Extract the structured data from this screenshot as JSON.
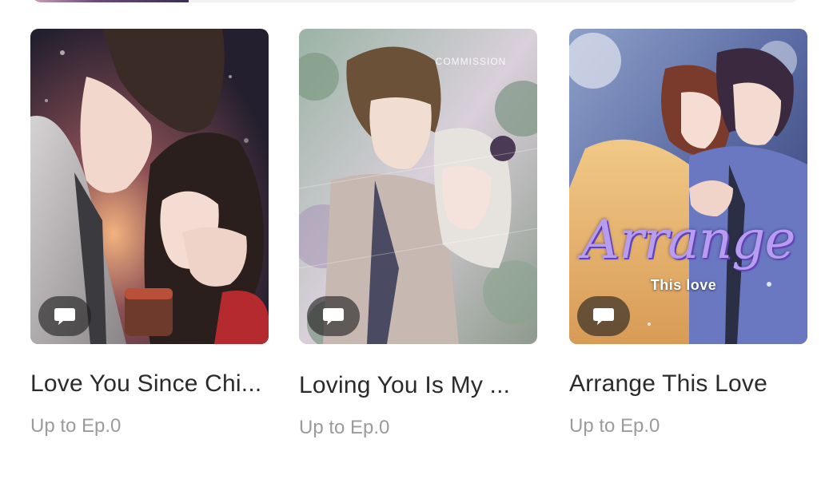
{
  "cards": [
    {
      "title": "Love You Since Chi...",
      "progress": "Up to Ep.0",
      "cover_colors": [
        "#2b2536",
        "#6a4b52",
        "#e7a57c"
      ],
      "badge_icon": "comment-bubble-icon"
    },
    {
      "title": "Loving You Is My ...",
      "progress": "Up to Ep.0",
      "cover_colors": [
        "#8fa596",
        "#d8cfd8",
        "#5a5f7a"
      ],
      "badge_icon": "comment-bubble-icon",
      "cover_text": "COMMISSION"
    },
    {
      "title": "Arrange This Love",
      "progress": "Up to Ep.0",
      "cover_colors": [
        "#5b6fa8",
        "#c9b8d6",
        "#f0c070"
      ],
      "badge_icon": "comment-bubble-icon",
      "cover_title": "Arrange",
      "cover_subtitle": "This love"
    }
  ]
}
